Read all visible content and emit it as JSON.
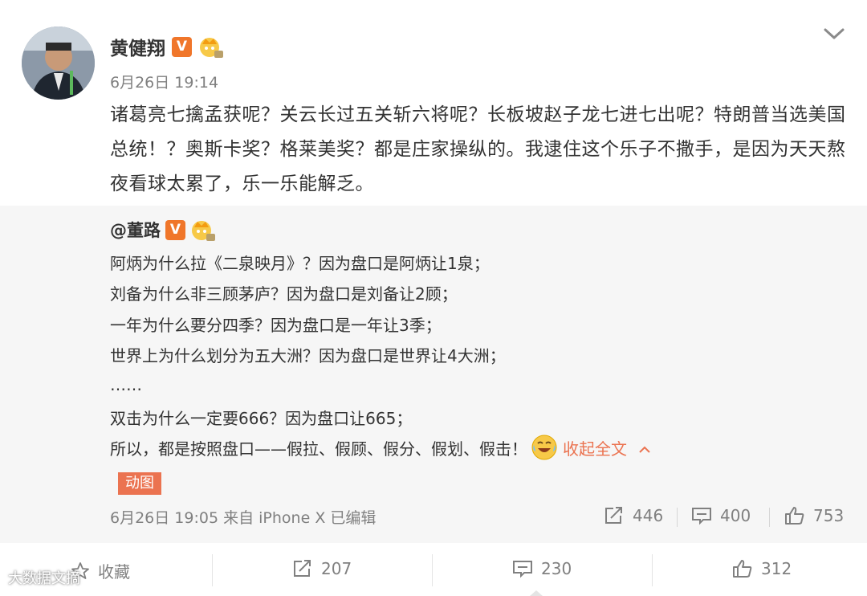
{
  "post": {
    "author": "黄健翔",
    "verified_badge": "V",
    "time": "6月26日 19:14",
    "text": "诸葛亮七擒孟获呢？关云长过五关斩六将呢？长板坡赵子龙七进七出呢？特朗普当选美国总统！？奥斯卡奖？格莱美奖？都是庄家操纵的。我逮住这个乐子不撒手，是因为天天熬夜看球太累了，乐一乐能解乏。"
  },
  "repost": {
    "author": "@董路",
    "verified_badge": "V",
    "lines": [
      "阿炳为什么拉《二泉映月》？因为盘口是阿炳让1泉；",
      "刘备为什么非三顾茅庐？因为盘口是刘备让2顾；",
      "一年为什么要分四季？因为盘口是一年让3季；",
      "世界上为什么划分为五大洲？因为盘口是世界让4大洲；",
      "……",
      "双击为什么一定要666？因为盘口让665；"
    ],
    "last_line": "所以，都是按照盘口——假拉、假顾、假分、假划、假击！",
    "collapse_label": "收起全文",
    "gif_tag": "动图",
    "meta": "6月26日 19:05 来自 iPhone X  已编辑",
    "reposts": "446",
    "comments": "400",
    "likes": "753"
  },
  "actions": {
    "favorite_label": "收藏",
    "reposts": "207",
    "comments": "230",
    "likes": "312"
  },
  "watermark": "大数据文摘",
  "colors": {
    "accent": "#eb7350",
    "badge": "#f0762a",
    "muted": "#808080",
    "repost_bg": "#f6f6f6"
  },
  "icons": [
    "chevron-down-icon",
    "crown-icon",
    "repost-icon",
    "comment-icon",
    "like-icon",
    "favorite-icon",
    "laugh-cry-emoji"
  ]
}
